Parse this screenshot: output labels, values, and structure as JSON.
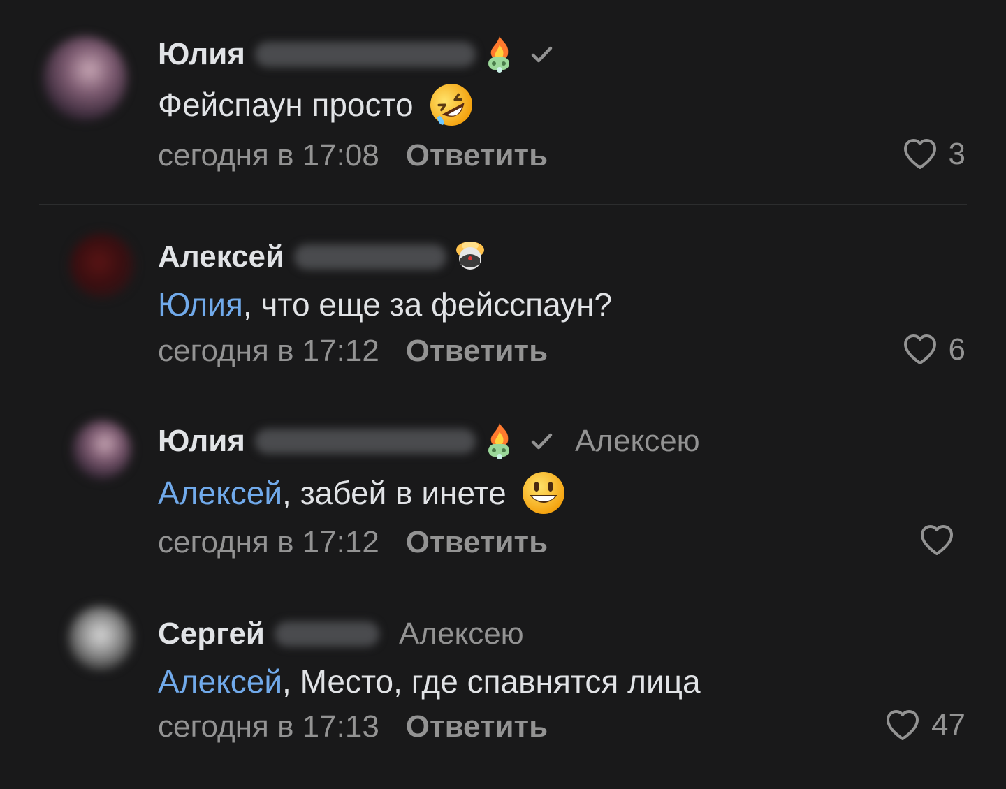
{
  "comments": [
    {
      "author": "Юлия",
      "text": "Фейспаун просто",
      "time": "сегодня в 17:08",
      "reply_label": "Ответить",
      "likes": "3",
      "emoji": "rolling-on-floor-laughing"
    },
    {
      "author": "Алексей",
      "mention": "Юлия",
      "text": ", что еще за фейсспаун?",
      "time": "сегодня в 17:12",
      "reply_label": "Ответить",
      "likes": "6"
    },
    {
      "author": "Юлия",
      "reply_to": "Алексею",
      "mention": "Алексей",
      "text": ", забей в инете",
      "time": "сегодня в 17:12",
      "reply_label": "Ответить",
      "likes": "",
      "emoji": "grinning-face"
    },
    {
      "author": "Сергей",
      "reply_to": "Алексею",
      "mention": "Алексей",
      "text": ", Место, где спавнятся лица",
      "time": "сегодня в 17:13",
      "reply_label": "Ответить",
      "likes": "47"
    }
  ],
  "colors": {
    "background": "#19191a",
    "text": "#e1e3e6",
    "secondary": "#939393",
    "mention": "#71aaeb",
    "divider": "#2c2d2e"
  },
  "icons": {
    "like": "heart-outline-icon",
    "verified": "checkmark-icon",
    "badge": "fire-controller-badge-icon"
  }
}
